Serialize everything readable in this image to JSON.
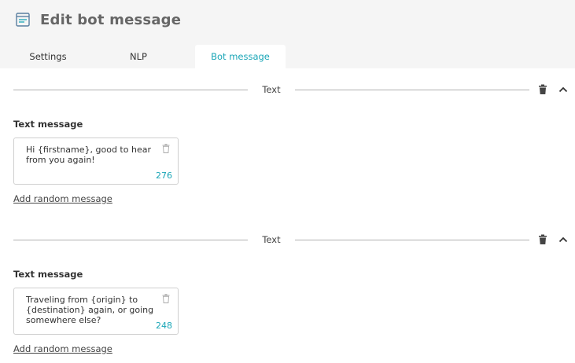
{
  "header": {
    "title": "Edit bot message",
    "icon": "message-window-icon"
  },
  "tabs": [
    {
      "label": "Settings",
      "active": false
    },
    {
      "label": "NLP",
      "active": false
    },
    {
      "label": "Bot message",
      "active": true
    }
  ],
  "sections": [
    {
      "type_label": "Text",
      "field_label": "Text message",
      "message": "Hi {firstname}, good to hear from you again!",
      "remaining_chars": "276",
      "add_link": "Add random message"
    },
    {
      "type_label": "Text",
      "field_label": "Text message",
      "message": "Traveling from {origin} to {destination} again, or going somewhere else?",
      "remaining_chars": "248",
      "add_link": "Add random message"
    }
  ],
  "colors": {
    "accent": "#1aa6b7",
    "topbar_bg": "#f5f5f5",
    "divider": "#b0b0b0"
  }
}
